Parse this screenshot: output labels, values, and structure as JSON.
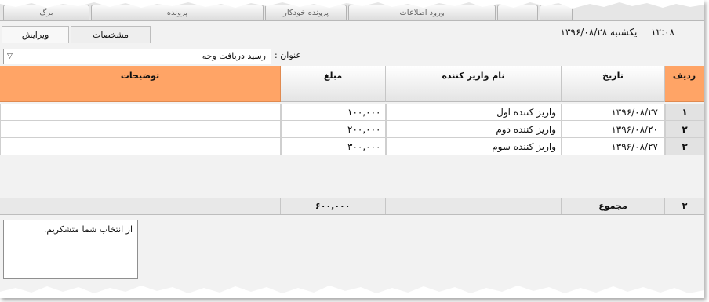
{
  "top_tabs": [
    {
      "label": "برگ"
    },
    {
      "label": "پرونده"
    },
    {
      "label": "پرونده خودکار"
    },
    {
      "label": "ورود اطلاعات"
    },
    {
      "label": ""
    },
    {
      "label": ""
    }
  ],
  "header": {
    "time": "۱۲:۰۸",
    "date": "یکشنبه ۱۳۹۶/۰۸/۲۸"
  },
  "subtabs": {
    "edit": "ویرایش",
    "specs": "مشخصات"
  },
  "form": {
    "title_label": "عنوان :",
    "title_value": "رسید دریافت وجه"
  },
  "table": {
    "columns": {
      "index": "ردیف",
      "date": "تاریخ",
      "payer": "نام واریز کننده",
      "amount": "مبلغ",
      "description": "توضیحات"
    },
    "rows": [
      {
        "index": "۱",
        "date": "۱۳۹۶/۰۸/۲۷",
        "payer": "واریز کننده اول",
        "amount": "۱۰۰,۰۰۰",
        "description": ""
      },
      {
        "index": "۲",
        "date": "۱۳۹۶/۰۸/۲۰",
        "payer": "واریز کننده دوم",
        "amount": "۲۰۰,۰۰۰",
        "description": ""
      },
      {
        "index": "۳",
        "date": "۱۳۹۶/۰۸/۲۷",
        "payer": "واریز کننده سوم",
        "amount": "۳۰۰,۰۰۰",
        "description": ""
      }
    ],
    "footer": {
      "count": "۳",
      "total_label": "مجموع",
      "total_amount": "۶۰۰,۰۰۰"
    }
  },
  "notes": {
    "text": "از انتخاب شما متشکریم."
  },
  "colors": {
    "header_accent": "#ffa466",
    "background": "#f2f2f2"
  }
}
